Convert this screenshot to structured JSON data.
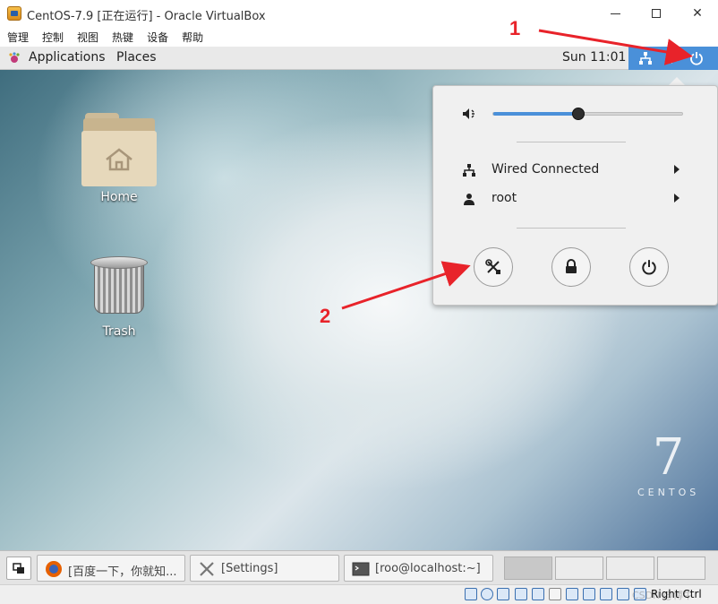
{
  "window": {
    "title": "CentOS-7.9 [正在运行] - Oracle VirtualBox"
  },
  "host_menu": [
    "管理",
    "控制",
    "视图",
    "热键",
    "设备",
    "帮助"
  ],
  "guest_panel": {
    "applications": "Applications",
    "places": "Places",
    "clock": "Sun 11:01"
  },
  "desktop": {
    "icons": [
      {
        "label": "Home",
        "icon": "home-folder-icon"
      },
      {
        "label": "Trash",
        "icon": "trash-icon"
      }
    ],
    "brand_numeral": "7",
    "brand_word": "CENTOS"
  },
  "system_menu": {
    "volume_level": 0.45,
    "network_label": "Wired Connected",
    "user_label": "root",
    "buttons": [
      "settings-icon",
      "lock-icon",
      "power-icon"
    ]
  },
  "annotations": {
    "marker_1": "1",
    "marker_2": "2",
    "color": "#e8232a"
  },
  "taskbar": {
    "items": [
      {
        "label": "[百度一下，你就知...",
        "icon": "firefox-icon"
      },
      {
        "label": "[Settings]",
        "icon": "settings-tools-icon"
      },
      {
        "label": "[roo@localhost:~]",
        "icon": "terminal-icon"
      }
    ]
  },
  "host_status": {
    "host_key": "Right Ctrl",
    "watermark": "CSDN @博牛"
  },
  "colors": {
    "accent": "#4a90d9",
    "popup_bg": "#f0f0f0"
  }
}
